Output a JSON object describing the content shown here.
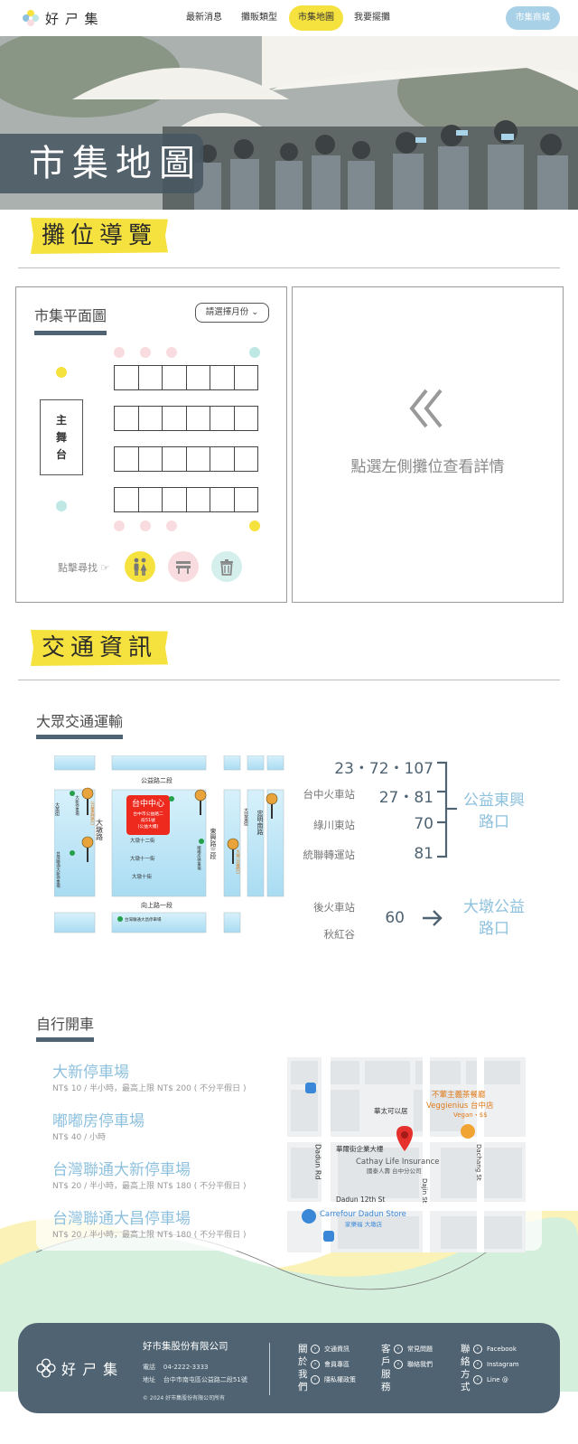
{
  "nav": {
    "logo_text": "好 ㄕ 集",
    "links": [
      "最新消息",
      "攤販類型",
      "市集地圖",
      "我要擺攤"
    ],
    "active_index": 2,
    "shop_label": "市集商城"
  },
  "hero": {
    "title": "市集地圖"
  },
  "booth_section": {
    "title": "攤位導覽",
    "plan_title": "市集平面圖",
    "month_select": "請選擇月份",
    "stage_chars": [
      "主",
      "舞",
      "台"
    ],
    "find_label": "點擊尋找",
    "find_buttons": [
      "restroom-icon",
      "bench-icon",
      "trash-icon"
    ],
    "detail_prompt": "點選左側攤位查看詳情"
  },
  "traffic_section": {
    "title": "交通資訊",
    "public_title": "大眾交通運輸",
    "transit_map": {
      "roads": [
        "公益路二段",
        "大墩路",
        "東興路三段",
        "忠明南路",
        "向上路一段",
        "大墩十二街",
        "大墩十一街",
        "大墩十街",
        "大英街",
        "大容東街",
        "大墩南路"
      ],
      "center": [
        "台中中心",
        "台中市公益路二",
        "段51號",
        "(公益大樓)"
      ],
      "parking": [
        "大新停車場",
        "嘟嘟房停車場",
        "台灣聯通大新停車場",
        "台灣聯通大昌停車場"
      ],
      "bus_stops": [
        "公益東興路口",
        "大墩公益路口"
      ]
    },
    "routes": [
      {
        "stop": "",
        "buses": "23・72・107"
      },
      {
        "stop": "台中火車站",
        "buses": "27・81"
      },
      {
        "stop": "綠川東站",
        "buses": "70"
      },
      {
        "stop": "統聯轉運站",
        "buses": "81"
      }
    ],
    "dest_1": [
      "公益東興",
      "路口"
    ],
    "route_2": {
      "stops": [
        "後火車站",
        "秋紅谷"
      ],
      "buses": "60"
    },
    "dest_2": [
      "大墩公益",
      "路口"
    ]
  },
  "parking_section": {
    "title": "自行開車",
    "lots": [
      {
        "name": "大新停車場",
        "note": "NT$ 10 / 半小時，最高上限 NT$ 200 ( 不分平假日 )"
      },
      {
        "name": "嘟嘟房停車場",
        "note": "NT$ 40 / 小時"
      },
      {
        "name": "台灣聯通大新停車場",
        "note": "NT$ 20 / 半小時，最高上限 NT$ 180 ( 不分平假日 )"
      },
      {
        "name": "台灣聯通大昌停車場",
        "note": "NT$ 20 / 半小時，最高上限 NT$ 180 ( 不分平假日 )"
      }
    ],
    "map": {
      "restaurant": [
        "不葷主義茶餐廳",
        "Veggienius 台中店",
        "Vegan・$$"
      ],
      "poi_1": "華太可以居",
      "poi_2": "華爾街企業大樓",
      "building": [
        "Cathay Life Insurance",
        "國泰人壽 台中分公司"
      ],
      "street_1": "Dadun Rd",
      "street_2": "Dadun 12th St",
      "street_3": "Dajin St",
      "street_4": "Dachang St",
      "store": [
        "Carrefour Dadun Store",
        "家樂福 大墩店"
      ]
    }
  },
  "footer": {
    "logo_text": "好 ㄕ 集",
    "company": "好市集股份有限公司",
    "phone_label": "電話",
    "phone": "04-2222-3333",
    "address_label": "地址",
    "address": "台中市南屯區公益路二段51號",
    "copyright": "© 2024 好市集股份有限公司所有",
    "columns": [
      {
        "cat": "關於我們",
        "items": [
          "交通資訊",
          "會員專區",
          "隱私權政策"
        ]
      },
      {
        "cat": "客戶服務",
        "items": [
          "常見問題",
          "聯絡我們"
        ]
      },
      {
        "cat": "聯絡方式",
        "items": [
          "Facebook",
          "Instagram",
          "Line @"
        ]
      }
    ]
  },
  "colors": {
    "accent_yellow": "#f6e23f",
    "slate": "#4f6372",
    "sky": "#8ec1de"
  }
}
